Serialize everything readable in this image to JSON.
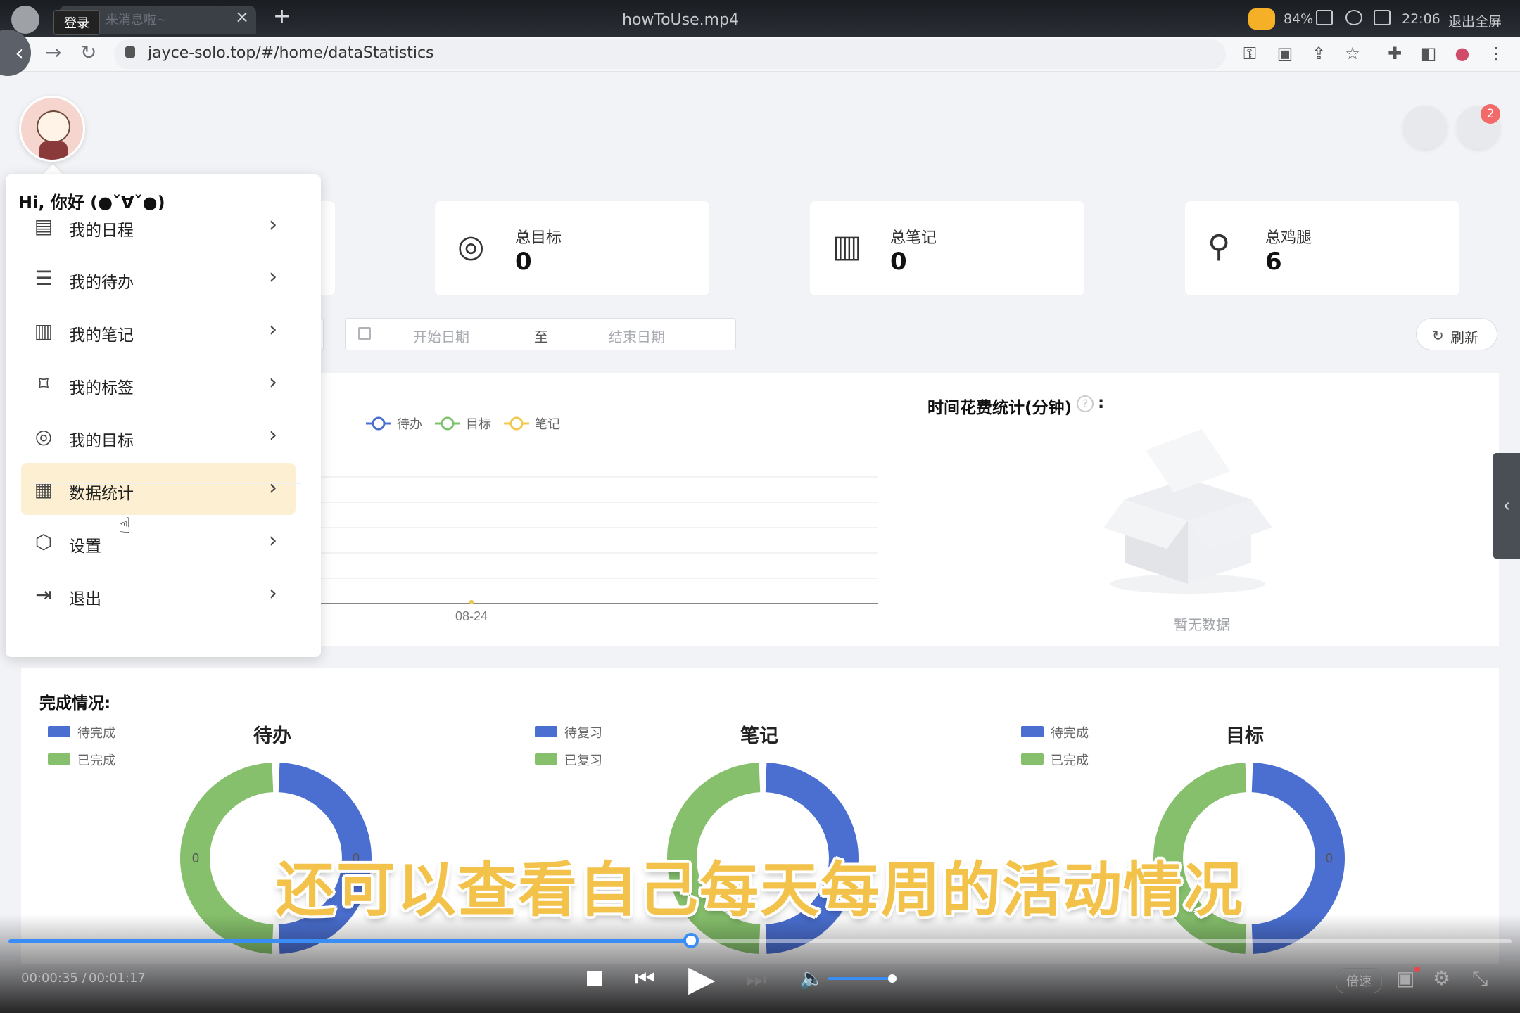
{
  "browser": {
    "tab_title": "来消息啦~",
    "login_tooltip": "登录",
    "window_title": "howToUse.mp4",
    "battery": "84%",
    "clock": "22:06",
    "exit_fullscreen": "退出全屏",
    "url": "jayce-solo.top/#/home/dataStatistics"
  },
  "header": {
    "notification_count": "2"
  },
  "stats": [
    {
      "label": "总目标",
      "value": "0",
      "icon": "target-icon"
    },
    {
      "label": "总笔记",
      "value": "0",
      "icon": "notebook-icon"
    },
    {
      "label": "总鸡腿",
      "value": "6",
      "icon": "drumstick-icon"
    }
  ],
  "filters": {
    "start_placeholder": "开始日期",
    "separator": "至",
    "end_placeholder": "结束日期",
    "refresh_label": "刷新"
  },
  "chart_data": [
    {
      "type": "line",
      "x": [
        "08-24"
      ],
      "series": [
        {
          "name": "待办",
          "values": [
            0
          ],
          "color": "#4a6fd0"
        },
        {
          "name": "目标",
          "values": [
            0
          ],
          "color": "#7ec36b"
        },
        {
          "name": "笔记",
          "values": [
            0
          ],
          "color": "#f2c94c"
        }
      ],
      "legend": "top-left",
      "grid": true
    },
    {
      "type": "pie",
      "title": "待办",
      "categories": [
        "待完成",
        "已完成"
      ],
      "values": [
        1,
        1
      ],
      "colors": [
        "#4a6fd0",
        "#86c06c"
      ],
      "labels": [
        "0",
        "0"
      ]
    },
    {
      "type": "pie",
      "title": "笔记",
      "categories": [
        "待复习",
        "已复习"
      ],
      "values": [
        1,
        1
      ],
      "colors": [
        "#4a6fd0",
        "#86c06c"
      ]
    },
    {
      "type": "pie",
      "title": "目标",
      "categories": [
        "待完成",
        "已完成"
      ],
      "values": [
        1,
        1
      ],
      "colors": [
        "#4a6fd0",
        "#86c06c"
      ],
      "labels": [
        "0"
      ]
    }
  ],
  "time_panel": {
    "title": "时间花费统计(分钟)",
    "help": "?",
    "colon": ":",
    "empty_text": "暂无数据"
  },
  "done_panel": {
    "title": "完成情况:"
  },
  "menu": {
    "greeting": "Hi, 你好 (●ˇ∀ˇ●)",
    "items": [
      {
        "label": "我的日程",
        "icon": "calendar-icon",
        "glyph": "▤"
      },
      {
        "label": "我的待办",
        "icon": "checklist-icon",
        "glyph": "☰"
      },
      {
        "label": "我的笔记",
        "icon": "notebook-icon",
        "glyph": "▥"
      },
      {
        "label": "我的标签",
        "icon": "bookmark-icon",
        "glyph": "⌑"
      },
      {
        "label": "我的目标",
        "icon": "target-icon",
        "glyph": "◎"
      },
      {
        "label": "数据统计",
        "icon": "chart-icon",
        "glyph": "▦"
      },
      {
        "label": "设置",
        "icon": "settings-icon",
        "glyph": "⬡"
      },
      {
        "label": "退出",
        "icon": "logout-icon",
        "glyph": "⇥"
      }
    ],
    "active_index": 5
  },
  "player": {
    "subtitle": "还可以查看自己每天每周的活动情况",
    "current_time": "00:00:35 /",
    "total_time": "00:01:17",
    "progress": 0.454,
    "speed_label": "倍速",
    "accent": "#3a8df4"
  }
}
